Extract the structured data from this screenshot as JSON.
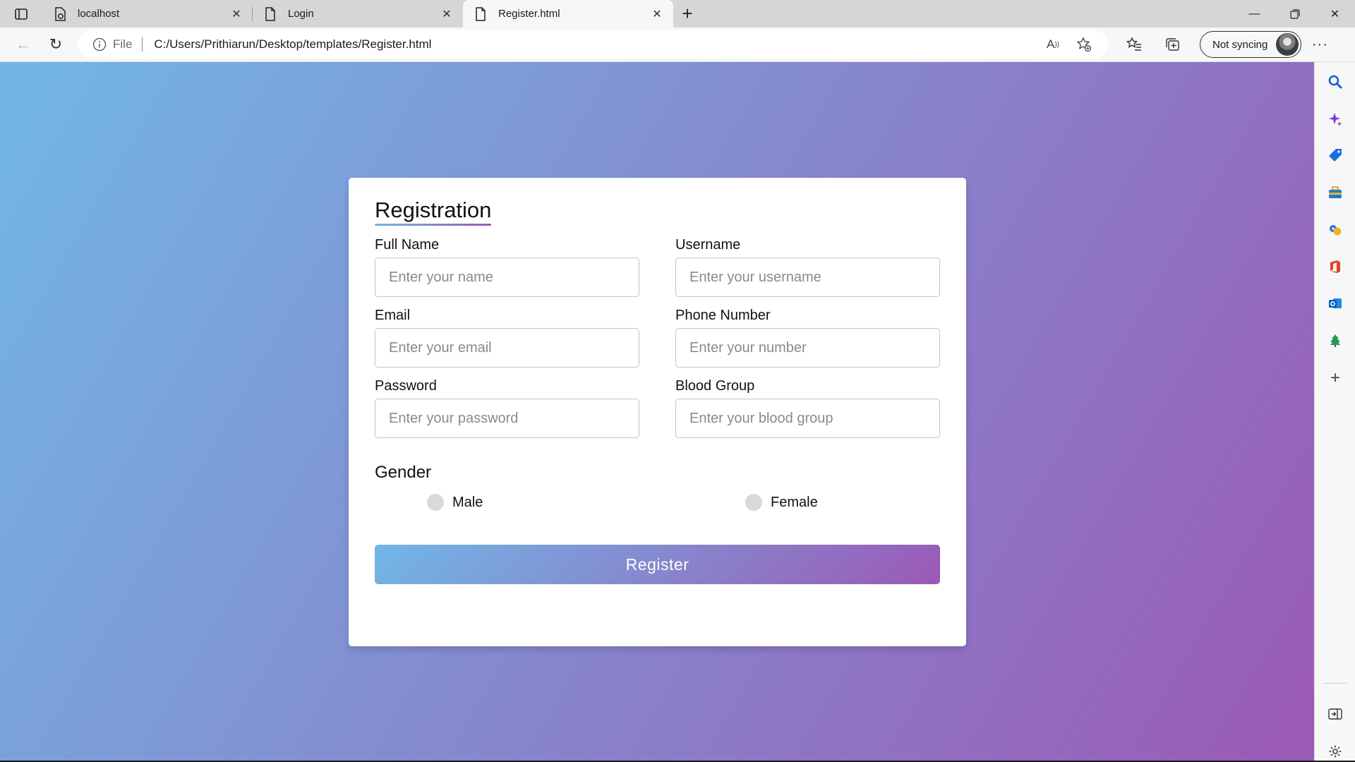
{
  "browser": {
    "tabs": [
      {
        "title": "localhost",
        "icon": "page-gear-icon",
        "active": false
      },
      {
        "title": "Login",
        "icon": "page-icon",
        "active": false
      },
      {
        "title": "Register.html",
        "icon": "page-icon",
        "active": true
      }
    ],
    "address": {
      "scheme": "File",
      "url": "C:/Users/Prithiarun/Desktop/templates/Register.html"
    },
    "sync_label": "Not syncing",
    "sidebar_icons": [
      "search-icon",
      "copilot-icon",
      "shopping-tag-icon",
      "tools-briefcase-icon",
      "games-icon",
      "office-icon",
      "outlook-icon",
      "tree-icon",
      "add-icon",
      "hide-sidebar-icon",
      "settings-icon"
    ]
  },
  "form": {
    "title": "Registration",
    "fields": {
      "full_name": {
        "label": "Full Name",
        "placeholder": "Enter your name"
      },
      "username": {
        "label": "Username",
        "placeholder": "Enter your username"
      },
      "email": {
        "label": "Email",
        "placeholder": "Enter your email"
      },
      "phone": {
        "label": "Phone Number",
        "placeholder": "Enter your number"
      },
      "password": {
        "label": "Password",
        "placeholder": "Enter your password"
      },
      "blood_group": {
        "label": "Blood Group",
        "placeholder": "Enter your blood group"
      }
    },
    "gender": {
      "title": "Gender",
      "options": [
        "Male",
        "Female"
      ]
    },
    "submit_label": "Register"
  },
  "colors": {
    "gradient_start": "#71b7e6",
    "gradient_end": "#9b59b6"
  }
}
